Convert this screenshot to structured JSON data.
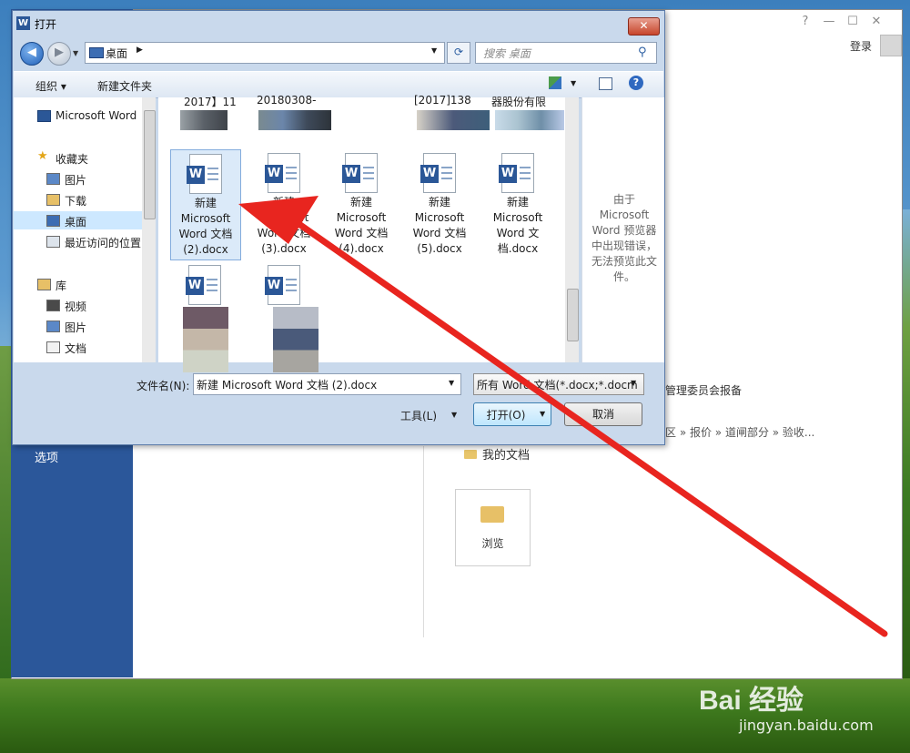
{
  "dialog": {
    "title": "打开",
    "close_glyph": "✕",
    "address": "桌面",
    "search_placeholder": "搜索 桌面",
    "toolbar": {
      "organize": "组织 ▾",
      "new_folder": "新建文件夹",
      "help": "?"
    },
    "nav_items": [
      {
        "label": "Microsoft Word",
        "icon": "word-icon"
      },
      {
        "label": "收藏夹",
        "icon": "star-icon"
      },
      {
        "label": "图片",
        "icon": "pictures-icon"
      },
      {
        "label": "下载",
        "icon": "download-icon"
      },
      {
        "label": "桌面",
        "icon": "desktop-icon",
        "selected": true
      },
      {
        "label": "最近访问的位置",
        "icon": "recent-icon"
      },
      {
        "label": "库",
        "icon": "library-icon"
      },
      {
        "label": "视频",
        "icon": "video-icon"
      },
      {
        "label": "图片",
        "icon": "pictures-icon"
      },
      {
        "label": "文档",
        "icon": "documents-icon"
      }
    ],
    "top_row_partial": [
      "2017】11",
      "20180308-",
      "[2017]138",
      "器股份有限"
    ],
    "files": [
      {
        "name": "新建 Microsoft Word 文档 (2).docx",
        "lines": [
          "新建",
          "Microsoft",
          "Word 文档",
          "(2).docx"
        ],
        "selected": true
      },
      {
        "name": "新建 Microsoft Word 文档 (3).docx",
        "lines": [
          "新建",
          "Microsoft",
          "Word 文档",
          "(3).docx"
        ]
      },
      {
        "name": "新建 Microsoft Word 文档 (4).docx",
        "lines": [
          "新建",
          "Microsoft",
          "Word 文档",
          "(4).docx"
        ]
      },
      {
        "name": "新建 Microsoft Word 文档 (5).docx",
        "lines": [
          "新建",
          "Microsoft",
          "Word 文档",
          "(5).docx"
        ]
      },
      {
        "name": "新建 Microsoft Word 文档.docx",
        "lines": [
          "新建",
          "Microsoft",
          "Word 文",
          "档.docx"
        ]
      }
    ],
    "preview_message": "由于 Microsoft Word 预览器中出现错误，无法预览此文件。",
    "filename_label": "文件名(N):",
    "filename_value": "新建 Microsoft Word 文档 (2).docx",
    "filter_value": "所有 Word 文档(*.docx;*.docm",
    "tools_label": "工具(L)",
    "open_label": "打开(O)",
    "cancel_label": "取消"
  },
  "word": {
    "titlebar": {
      "help": "?",
      "minimize": "—",
      "maximize": "☐",
      "close": "✕"
    },
    "login": "登录",
    "left_panel_item": "选项",
    "recent_1": "管理委员会报备",
    "recent_2": "区 » 报价 » 道闸部分 » 验收...",
    "my_documents": "我的文档",
    "browse": "浏览"
  },
  "watermark": {
    "logo": "Bai 经验",
    "url": "jingyan.baidu.com"
  },
  "colors": {
    "word_blue": "#2b579a",
    "arrow": "#e8251f",
    "dialog_chrome": "#c9d9ec"
  }
}
